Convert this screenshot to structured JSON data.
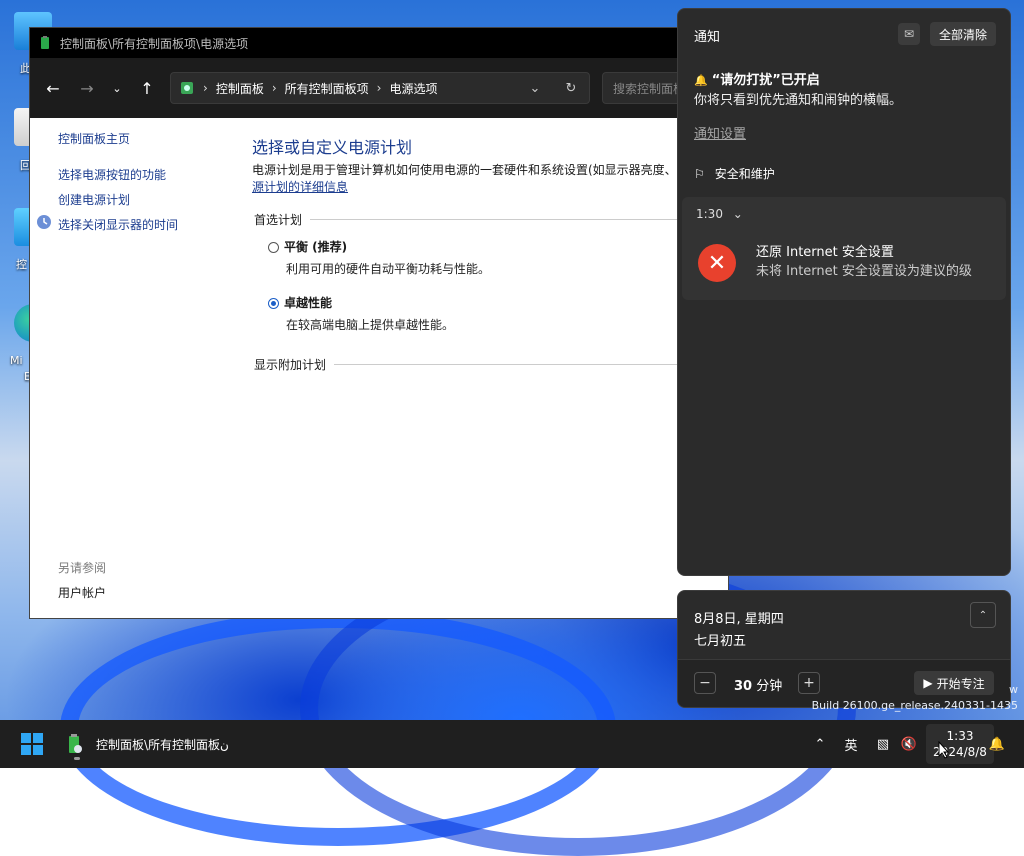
{
  "window": {
    "title": "控制面板\\所有控制面板项\\电源选项",
    "breadcrumb": [
      "控制面板",
      "所有控制面板项",
      "电源选项"
    ],
    "search_placeholder": "搜索控制面板"
  },
  "sidebar": {
    "home": "控制面板主页",
    "links": [
      "选择电源按钮的功能",
      "创建电源计划",
      "选择关闭显示器的时间"
    ],
    "see_also": "另请参阅",
    "user_accounts": "用户帐户"
  },
  "main": {
    "title": "选择或自定义电源计划",
    "desc_line1": "电源计划是用于管理计算机如何使用电源的一套硬件和系统设置(如显示器亮度、",
    "desc_link": "源计划的详细信息",
    "preferred": "首选计划",
    "plans": [
      {
        "name": "平衡 (推荐)",
        "desc": "利用可用的硬件自动平衡功耗与性能。",
        "selected": false
      },
      {
        "name": "卓越性能",
        "desc": "在较高端电脑上提供卓越性能。",
        "selected": true
      }
    ],
    "show_more": "显示附加计划"
  },
  "notifications": {
    "header": "通知",
    "clear_all": "全部清除",
    "dnd_title": "“请勿打扰”已开启",
    "dnd_text": "你将只看到优先通知和闹钟的横幅。",
    "settings_link": "通知设置",
    "group": "安全和维护",
    "card": {
      "time": "1:30",
      "title": "还原 Internet 安全设置",
      "text": "未将 Internet 安全设置设为建议的级"
    }
  },
  "calendar": {
    "date": "8月8日, 星期四",
    "lunar": "七月初五",
    "focus_minutes": "30",
    "minutes_unit": "分钟",
    "start_focus": "开始专注"
  },
  "watermark": {
    "line1": "w",
    "line2": "Build 26100.ge_release.240331-1435"
  },
  "desktop": {
    "labels": [
      "此",
      "回",
      "控",
      "Mi",
      "E"
    ]
  },
  "taskbar": {
    "app_label": "控制面板\\所有控制面板ن",
    "ime": "英",
    "time": "1:33",
    "date": "2024/8/8"
  },
  "colors": {
    "accent": "#1c5fc7",
    "link": "#1c3d8f",
    "error": "#e8412d"
  }
}
